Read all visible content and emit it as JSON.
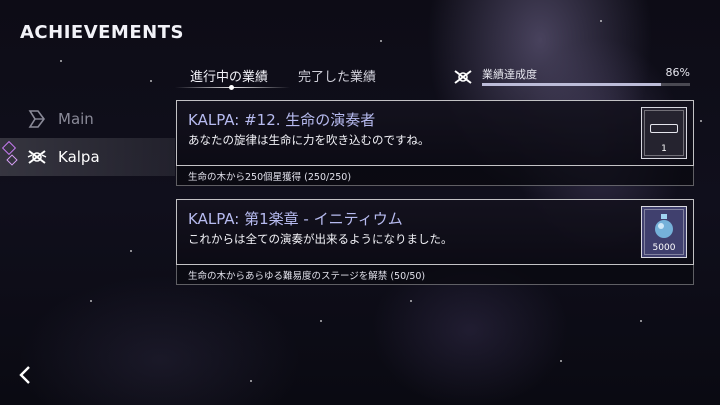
{
  "screen": {
    "title": "ACHIEVEMENTS"
  },
  "sidebar": {
    "items": [
      {
        "label": "Main",
        "icon": "main-icon",
        "selected": false
      },
      {
        "label": "Kalpa",
        "icon": "kalpa-icon",
        "selected": true
      }
    ]
  },
  "tabs": [
    {
      "label": "進行中の業績",
      "active": true
    },
    {
      "label": "完了した業績",
      "active": false
    }
  ],
  "progress": {
    "label": "業績達成度",
    "value_text": "86%",
    "percent": 86
  },
  "achievements": [
    {
      "title": "KALPA: #12. 生命の演奏者",
      "description": "あなたの旋律は生命に力を吹き込むのですね。",
      "condition": "生命の木から250個星獲得 (250/250)",
      "reward_icon": "nameplate-icon",
      "reward_value": "1"
    },
    {
      "title": "KALPA: 第1楽章 - イニティウム",
      "description": "これからは全ての演奏が出来るようになりました。",
      "condition": "生命の木からあらゆる難易度のステージを解禁 (50/50)",
      "reward_icon": "potion-icon",
      "reward_value": "5000"
    }
  ],
  "colors": {
    "accent": "#b7bbf0",
    "gem": "#c57af0",
    "progress_fill": "#bcbcd8"
  }
}
